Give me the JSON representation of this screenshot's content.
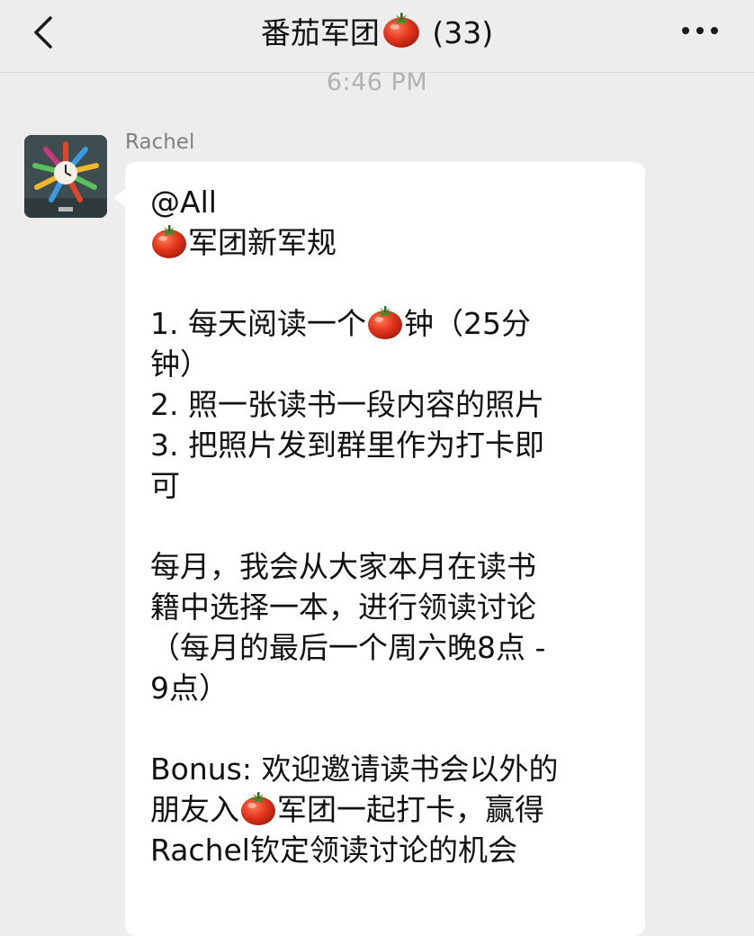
{
  "header": {
    "title_prefix": "番茄军团",
    "title_suffix": " (33)",
    "back_icon": "chevron-left-icon",
    "more_icon": "more-dots-icon"
  },
  "timestamp": "6:46 PM",
  "message": {
    "sender": "Rachel",
    "avatar": "clock-avatar",
    "lines": {
      "l1": "@All",
      "l2_after": "军团新军规",
      "l3_before": "1. 每天阅读一个",
      "l3_after": "钟（25分",
      "l4": "钟）",
      "l5": "2. 照一张读书一段内容的照片",
      "l6": "3. 把照片发到群里作为打卡即",
      "l7": "可",
      "l8": "每月，我会从大家本月在读书",
      "l9": "籍中选择一本，进行领读讨论",
      "l10": "（每月的最后一个周六晚8点 -",
      "l11": "9点）",
      "l12": "Bonus: 欢迎邀请读书会以外的",
      "l13_before": "朋友入",
      "l13_after": "军团一起打卡，赢得",
      "l14": "Rachel钦定领读讨论的机会"
    }
  },
  "colors": {
    "background": "#ededed",
    "bubble": "#ffffff",
    "text": "#111111",
    "meta": "#b2b2b2",
    "tomato": "#e03a1f"
  }
}
